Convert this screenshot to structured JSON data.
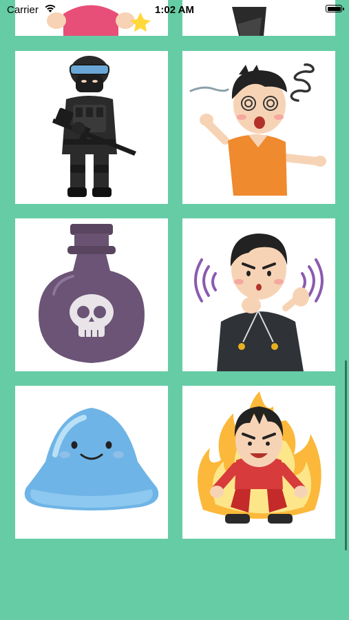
{
  "status_bar": {
    "carrier": "Carrier",
    "time": "1:02 AM",
    "battery_icon": "battery-icon",
    "wifi_icon": "wifi-icon"
  },
  "grid": {
    "background_color": "#66cca6",
    "cells": [
      {
        "name": "pink-character-partial",
        "icon": "pink-shirt-person-icon"
      },
      {
        "name": "black-object-partial",
        "icon": "dark-object-icon"
      },
      {
        "name": "swat-soldier",
        "icon": "soldier-with-rifle-icon"
      },
      {
        "name": "dizzy-man",
        "icon": "dizzy-man-icon"
      },
      {
        "name": "poison-bottle",
        "icon": "poison-bottle-skull-icon"
      },
      {
        "name": "hypnotist",
        "icon": "man-with-pendulum-icon"
      },
      {
        "name": "blue-slime",
        "icon": "smiling-slime-icon"
      },
      {
        "name": "fired-up-man",
        "icon": "man-with-flame-aura-icon"
      }
    ]
  }
}
